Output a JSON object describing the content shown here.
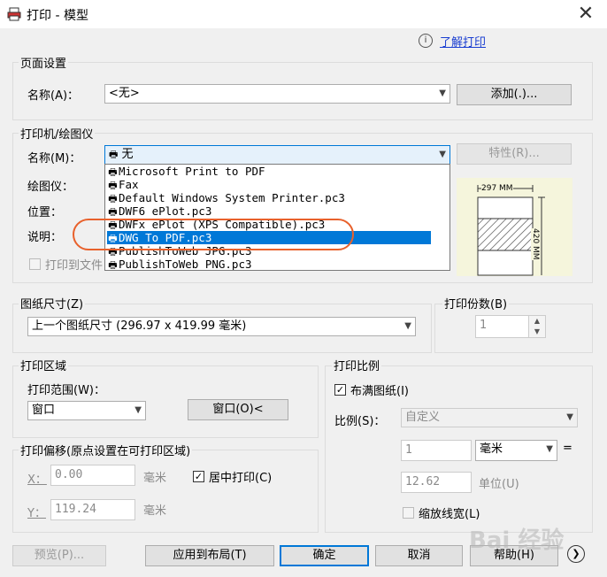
{
  "window": {
    "title": "打印 - 模型"
  },
  "help": {
    "link": "了解打印"
  },
  "page_setup": {
    "title": "页面设置",
    "name_label": "名称(A)：",
    "name_value": "<无>",
    "add_button": "添加(.)..."
  },
  "printer": {
    "title": "打印机/绘图仪",
    "name_label": "名称(M)：",
    "name_value": "无",
    "properties_button": "特性(R)...",
    "plotter_label": "绘图仪：",
    "location_label": "位置：",
    "description_label": "说明：",
    "print_to_file": "打印到文件",
    "dropdown_items": [
      "Microsoft Print to PDF",
      "Fax",
      "Default Windows System Printer.pc3",
      "DWF6 ePlot.pc3",
      "DWFx ePlot (XPS Compatible).pc3",
      "DWG To PDF.pc3",
      "PublishToWeb JPG.pc3",
      "PublishToWeb PNG.pc3"
    ],
    "selected_index": 5,
    "preview": {
      "width_label": "297 MM",
      "height_label": "420 MM"
    }
  },
  "paper_size": {
    "title": "图纸尺寸(Z)",
    "value": "上一个图纸尺寸 (296.97 x 419.99 毫米)"
  },
  "copies": {
    "title": "打印份数(B)",
    "value": "1"
  },
  "plot_area": {
    "title": "打印区域",
    "range_label": "打印范围(W)：",
    "range_value": "窗口",
    "window_button": "窗口(O)<"
  },
  "plot_scale": {
    "title": "打印比例",
    "fit_paper": "布满图纸(I)",
    "scale_label": "比例(S)：",
    "scale_value": "自定义",
    "value1": "1",
    "unit_value": "毫米",
    "equals": "=",
    "value2": "12.62",
    "unit_label": "单位(U)",
    "scale_lineweights": "缩放线宽(L)"
  },
  "plot_offset": {
    "title": "打印偏移(原点设置在可打印区域)",
    "x_label": "X：",
    "x_value": "0.00",
    "x_unit": "毫米",
    "y_label": "Y：",
    "y_value": "119.24",
    "y_unit": "毫米",
    "center_plot": "居中打印(C)"
  },
  "footer": {
    "preview_button": "预览(P)...",
    "apply_button": "应用到布局(T)",
    "ok_button": "确定",
    "cancel_button": "取消",
    "help_button": "帮助(H)"
  },
  "watermark": "Bai 经验",
  "colors": {
    "accent": "#0078d7",
    "highlight_oval": "#e8612c",
    "link": "#1a3ed1"
  }
}
